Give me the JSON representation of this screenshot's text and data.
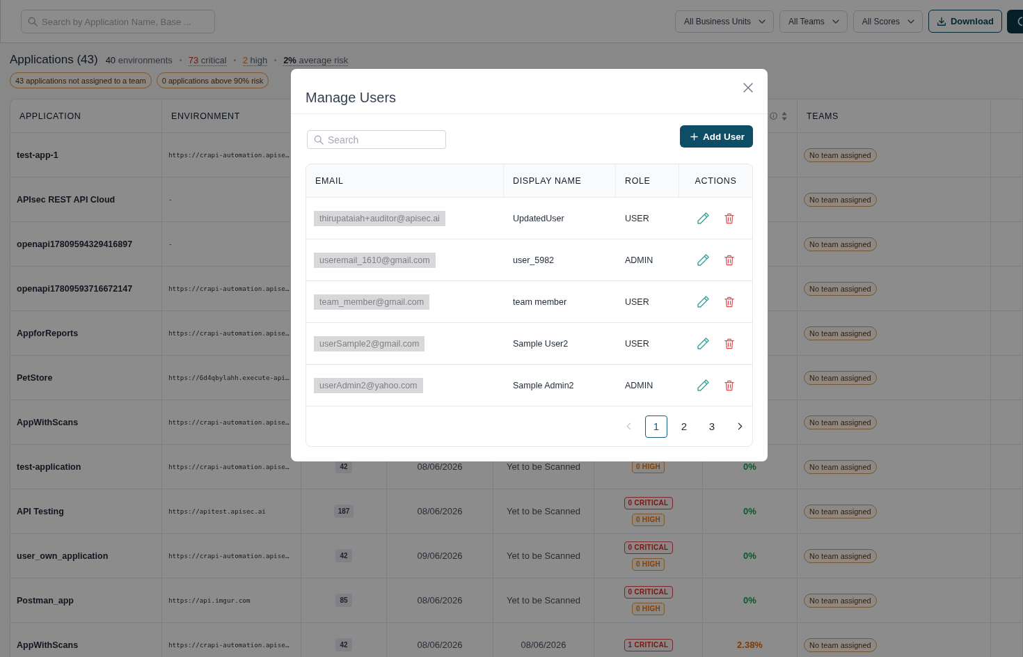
{
  "toolbar": {
    "search": {
      "placeholder": "Search by Application Name, Base ..."
    },
    "filters": [
      {
        "label": "All Business Units"
      },
      {
        "label": "All Teams"
      },
      {
        "label": "All Scores"
      }
    ],
    "download_button": "Download"
  },
  "summary": {
    "title": "Applications (43)",
    "stats": [
      {
        "kind": "count",
        "number": "40",
        "noun": "environments"
      },
      {
        "kind": "critical",
        "number": "73",
        "noun": "critical"
      },
      {
        "kind": "high",
        "number": "2",
        "noun": "high"
      },
      {
        "kind": "risk",
        "number": "2%",
        "noun": "average risk"
      }
    ],
    "chips": [
      "43 applications not assigned to a team",
      "0 applications above 90% risk"
    ]
  },
  "table": {
    "columns": {
      "application": "APPLICATION",
      "environment": "ENVIRONMENT",
      "teams": "TEAMS"
    },
    "rows": [
      {
        "application": "test-app-1",
        "environment": "https://crapi-automation.apise…",
        "team": "No team assigned"
      },
      {
        "application": "APIsec REST API Cloud",
        "environment": "-",
        "team": "No team assigned"
      },
      {
        "application": "openapi17809594329416897",
        "environment": "-",
        "team": "No team assigned"
      },
      {
        "application": "openapi17809593716672147",
        "environment": "https://crapi-automation.apise…",
        "team": "No team assigned"
      },
      {
        "application": "AppforReports",
        "environment": "https://crapi-automation.apise…",
        "team": "No team assigned"
      },
      {
        "application": "PetStore",
        "environment": "https://6d4qbylahh.execute-api…",
        "team": "No team assigned"
      },
      {
        "application": "AppWithScans",
        "environment": "https://crapi-automation.apise…",
        "team": "No team assigned"
      },
      {
        "application": "test-application",
        "environment": "https://crapi-automation.apise…",
        "count": "42",
        "date": "08/06/2026",
        "status": "Yet to be Scanned",
        "severity": [
          {
            "kind": "high",
            "label": "0 HIGH"
          }
        ],
        "risk": {
          "text": "0%",
          "kind": "low"
        },
        "team": "No team assigned"
      },
      {
        "application": "API Testing",
        "environment": "https://apitest.apisec.ai",
        "count": "187",
        "date": "08/06/2026",
        "status": "Yet to be Scanned",
        "severity": [
          {
            "kind": "critical",
            "label": "0 CRITICAL"
          },
          {
            "kind": "high",
            "label": "0 HIGH"
          }
        ],
        "risk": {
          "text": "0%",
          "kind": "low"
        },
        "team": "No team assigned"
      },
      {
        "application": "user_own_application",
        "environment": "https://crapi-automation.apise…",
        "count": "42",
        "date": "09/06/2026",
        "status": "Yet to be Scanned",
        "severity": [
          {
            "kind": "critical",
            "label": "0 CRITICAL"
          },
          {
            "kind": "high",
            "label": "0 HIGH"
          }
        ],
        "risk": {
          "text": "0%",
          "kind": "low"
        },
        "team": "No team assigned"
      },
      {
        "application": "Postman_app",
        "environment": "https://api.imgur.com",
        "count": "85",
        "date": "08/06/2026",
        "status": "Yet to be Scanned",
        "severity": [
          {
            "kind": "critical",
            "label": "0 CRITICAL"
          },
          {
            "kind": "high",
            "label": "0 HIGH"
          }
        ],
        "risk": {
          "text": "0%",
          "kind": "low"
        },
        "team": "No team assigned"
      },
      {
        "application": "AppWithScans",
        "environment": "https://crapi-automation.apise…",
        "count": "42",
        "date": "08/06/2026",
        "status": "08/06/2026",
        "severity": [
          {
            "kind": "critical",
            "label": "1 CRITICAL"
          }
        ],
        "risk": {
          "text": "2.38%",
          "kind": "medium"
        },
        "team": "No team assigned"
      }
    ]
  },
  "modal": {
    "title": "Manage Users",
    "search": {
      "placeholder": "Search"
    },
    "add_button": "Add User",
    "columns": [
      "EMAIL",
      "DISPLAY NAME",
      "ROLE",
      "ACTIONS"
    ],
    "users": [
      {
        "email": "thirupataiah+auditor@apisec.ai",
        "display_name": "UpdatedUser",
        "role": "USER"
      },
      {
        "email": "useremail_1610@gmail.com",
        "display_name": "user_5982",
        "role": "ADMIN"
      },
      {
        "email": "team_member@gmail.com",
        "display_name": "team member",
        "role": "USER"
      },
      {
        "email": "userSample2@gmail.com",
        "display_name": "Sample User2",
        "role": "USER"
      },
      {
        "email": "userAdmin2@yahoo.com",
        "display_name": "Sample Admin2",
        "role": "ADMIN"
      }
    ],
    "pagination": {
      "prev": {
        "disabled": true
      },
      "pages": [
        {
          "label": "1",
          "selected": true
        },
        {
          "label": "2",
          "selected": false
        },
        {
          "label": "3",
          "selected": false
        }
      ],
      "next": {
        "disabled": false
      }
    }
  }
}
